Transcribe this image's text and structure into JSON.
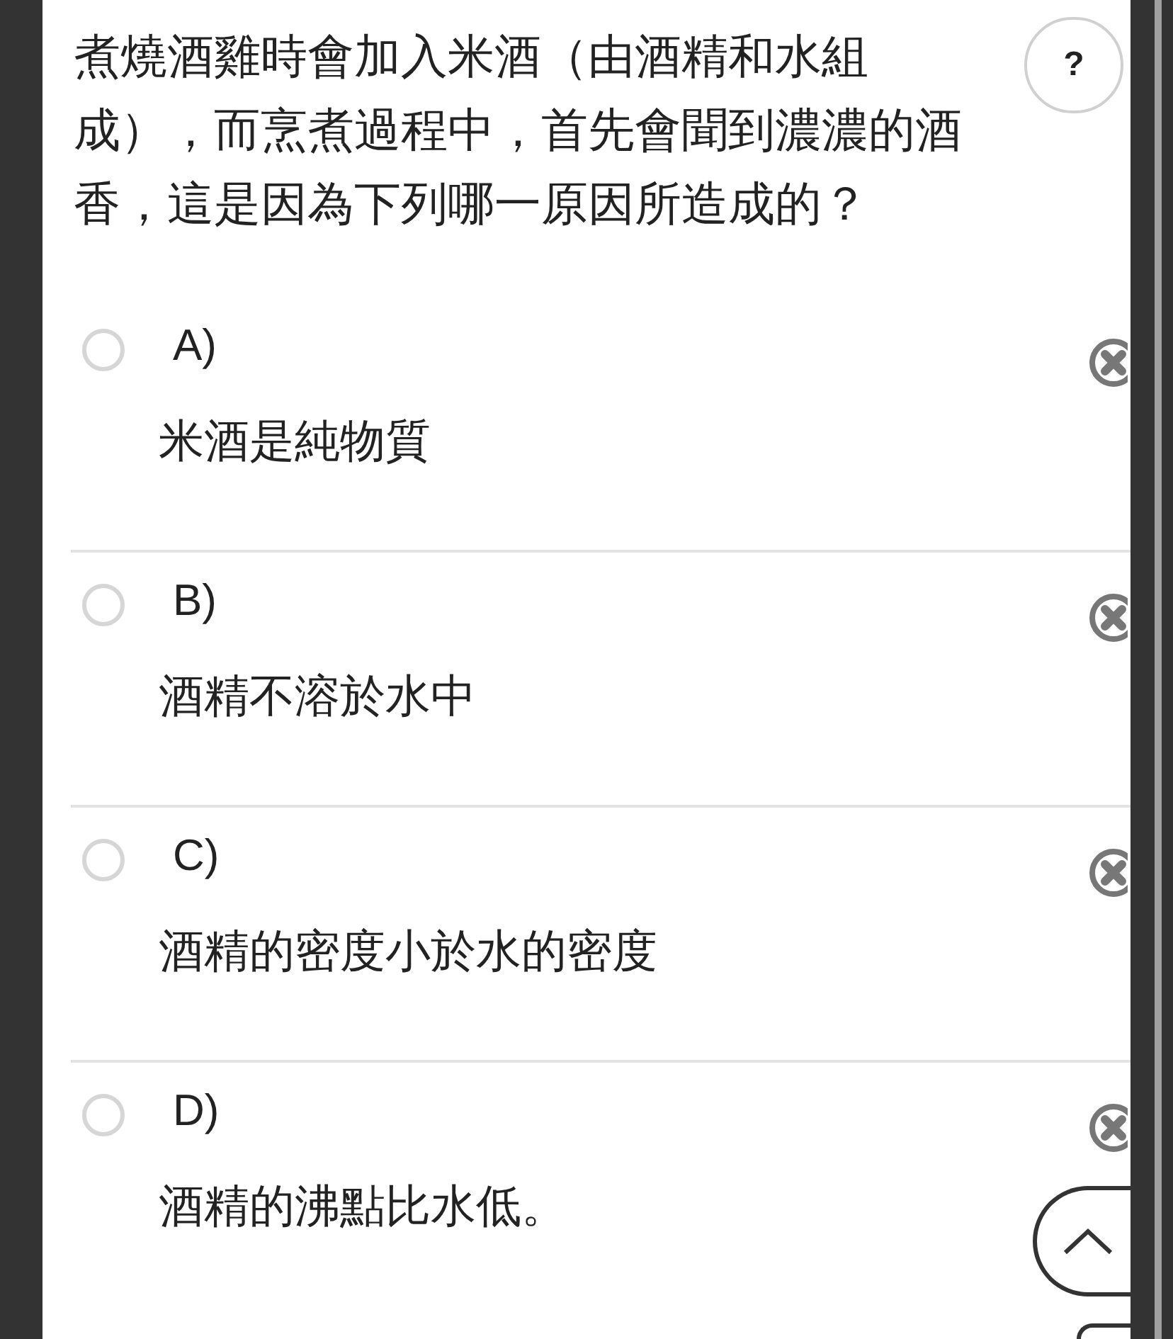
{
  "question": {
    "text": "煮燒酒雞時會加入米酒（由酒精和水組成），而烹煮過程中，首先會聞到濃濃的酒香，這是因為下列哪一原因所造成的？"
  },
  "help_button": {
    "label": "?"
  },
  "options": [
    {
      "label": "A)",
      "text": "米酒是純物質",
      "selected": false
    },
    {
      "label": "B)",
      "text": "酒精不溶於水中",
      "selected": false
    },
    {
      "label": "C)",
      "text": "酒精的密度小於水的密度",
      "selected": false
    },
    {
      "label": "D)",
      "text": "酒精的沸點比水低。",
      "selected": false
    }
  ]
}
